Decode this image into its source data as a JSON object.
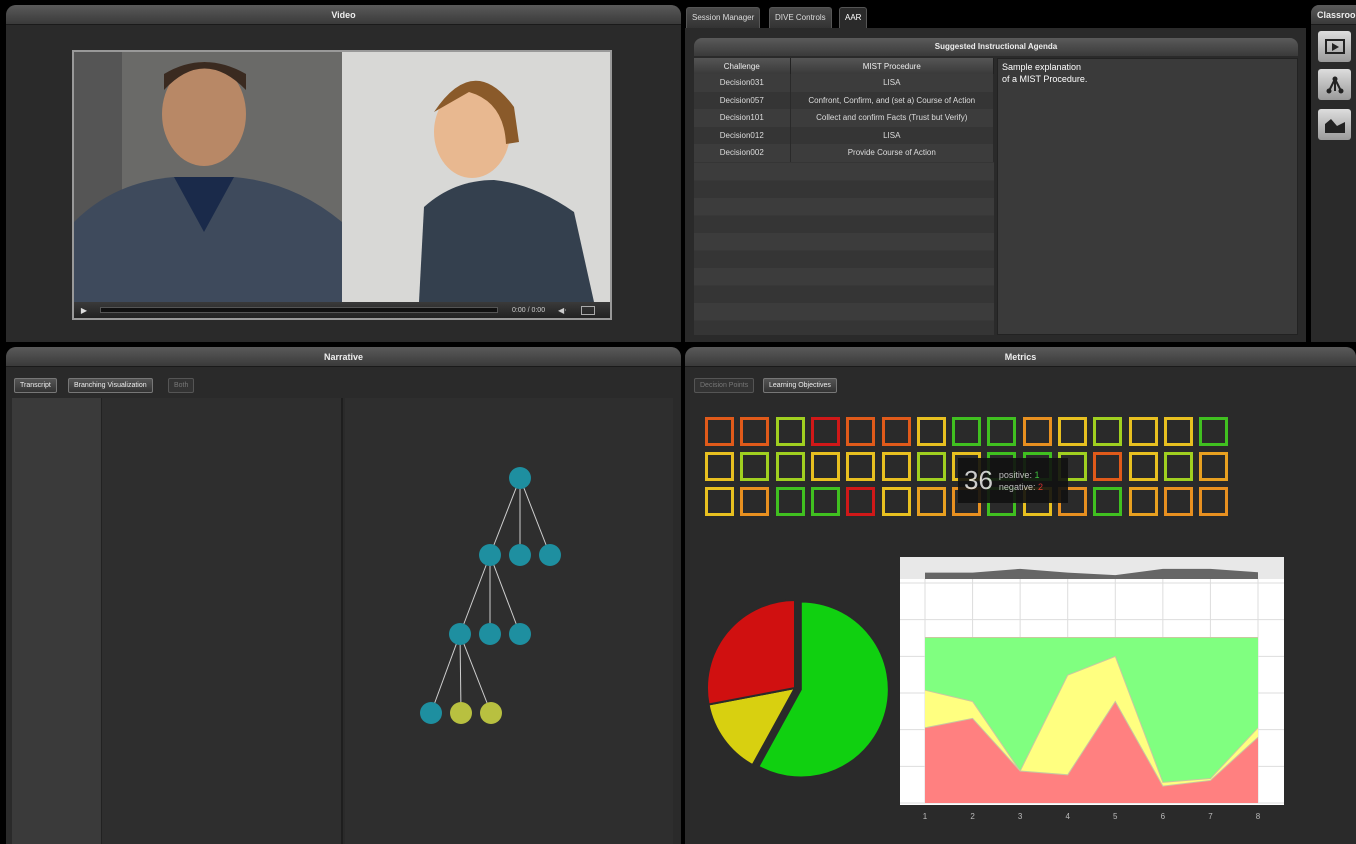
{
  "video": {
    "title": "Video",
    "time": "0:00 / 0:00"
  },
  "tabs": [
    {
      "label": "Session Manager"
    },
    {
      "label": "DIVE Controls"
    },
    {
      "label": "AAR"
    }
  ],
  "classroom": {
    "title": "Classroo..."
  },
  "agenda": {
    "title": "Suggested Instructional Agenda",
    "columns": [
      "Challenge",
      "MIST Procedure"
    ],
    "rows": [
      {
        "challenge": "Decision031",
        "procedure": "LISA"
      },
      {
        "challenge": "Decision057",
        "procedure": "Confront, Confirm, and (set a) Course of Action"
      },
      {
        "challenge": "Decision101",
        "procedure": "Collect and confirm Facts (Trust but Verify)"
      },
      {
        "challenge": "Decision012",
        "procedure": "LISA"
      },
      {
        "challenge": "Decision002",
        "procedure": "Provide Course of Action"
      }
    ],
    "explanation": "Sample explanation of a MIST Procedure."
  },
  "narrative": {
    "title": "Narrative",
    "buttons": {
      "transcript": "Transcript",
      "branching": "Branching Visualization",
      "both": "Both"
    },
    "tree_nodes": [
      {
        "id": 0,
        "color": "#1e8fa0",
        "parent": null
      },
      {
        "id": 1,
        "color": "#1e8fa0",
        "parent": 0
      },
      {
        "id": 2,
        "color": "#1e8fa0",
        "parent": 0
      },
      {
        "id": 3,
        "color": "#1e8fa0",
        "parent": 0
      },
      {
        "id": 4,
        "color": "#1e8fa0",
        "parent": 1
      },
      {
        "id": 5,
        "color": "#1e8fa0",
        "parent": 1
      },
      {
        "id": 6,
        "color": "#1e8fa0",
        "parent": 1
      },
      {
        "id": 7,
        "color": "#1e8fa0",
        "parent": 4
      },
      {
        "id": 8,
        "color": "#b8c040",
        "parent": 4
      },
      {
        "id": 9,
        "color": "#b8c040",
        "parent": 4
      }
    ]
  },
  "metrics": {
    "title": "Metrics",
    "buttons": {
      "decision_points": "Decision Points",
      "learning_objectives": "Learning Objectives"
    },
    "tooltip": {
      "count": "36",
      "positive_label": "positive:",
      "positive": "1",
      "negative_label": "negative:",
      "negative": "2"
    },
    "grid_colors": [
      [
        "#e05a1a",
        "#e05a1a",
        "#a0d020",
        "#d01818",
        "#e05a1a",
        "#e05a1a",
        "#e8c020",
        "#40c020",
        "#40c020",
        "#e89020",
        "#e8c020",
        "#a0d020",
        "#e8c020",
        "#e8c020",
        "#40c020"
      ],
      [
        "#e8c020",
        "#a0d020",
        "#a0d020",
        "#e8c020",
        "#e8c020",
        "#e8c020",
        "#a0d020",
        "#e8c020",
        "#40c020",
        "#40c020",
        "#a0d020",
        "#e05a1a",
        "#e8c020",
        "#a0d020",
        "#e8a020"
      ],
      [
        "#e8c020",
        "#e89020",
        "#40c020",
        "#40c020",
        "#d01818",
        "#e8c020",
        "#e8a020",
        "#e89020",
        "#40c020",
        "#e8c020",
        "#e89020",
        "#40c020",
        "#e8a020",
        "#e89020",
        "#e89020"
      ]
    ]
  },
  "chart_data": [
    {
      "type": "pie",
      "values": [
        58,
        14,
        28
      ],
      "colors": [
        "#10d010",
        "#d8d010",
        "#d01010"
      ]
    },
    {
      "type": "area",
      "x": [
        1,
        2,
        3,
        4,
        5,
        6,
        7,
        8
      ],
      "series": [
        {
          "values": [
            0.4,
            0.45,
            0.17,
            0.15,
            0.54,
            0.09,
            0.12,
            0.35
          ],
          "color": "#ff8080"
        },
        {
          "values": [
            0.6,
            0.54,
            0.17,
            0.68,
            0.78,
            0.11,
            0.13,
            0.4
          ],
          "color": "#ffff80"
        },
        {
          "values": [
            0.88,
            0.88,
            0.88,
            0.88,
            0.88,
            0.88,
            0.88,
            0.88
          ],
          "color": "#80ff80"
        }
      ],
      "overview": [
        0.36,
        0.36,
        0.68,
        0.36,
        0.16,
        0.68,
        0.68,
        0.4
      ],
      "ylim": [
        0,
        1
      ],
      "grid": true
    }
  ]
}
